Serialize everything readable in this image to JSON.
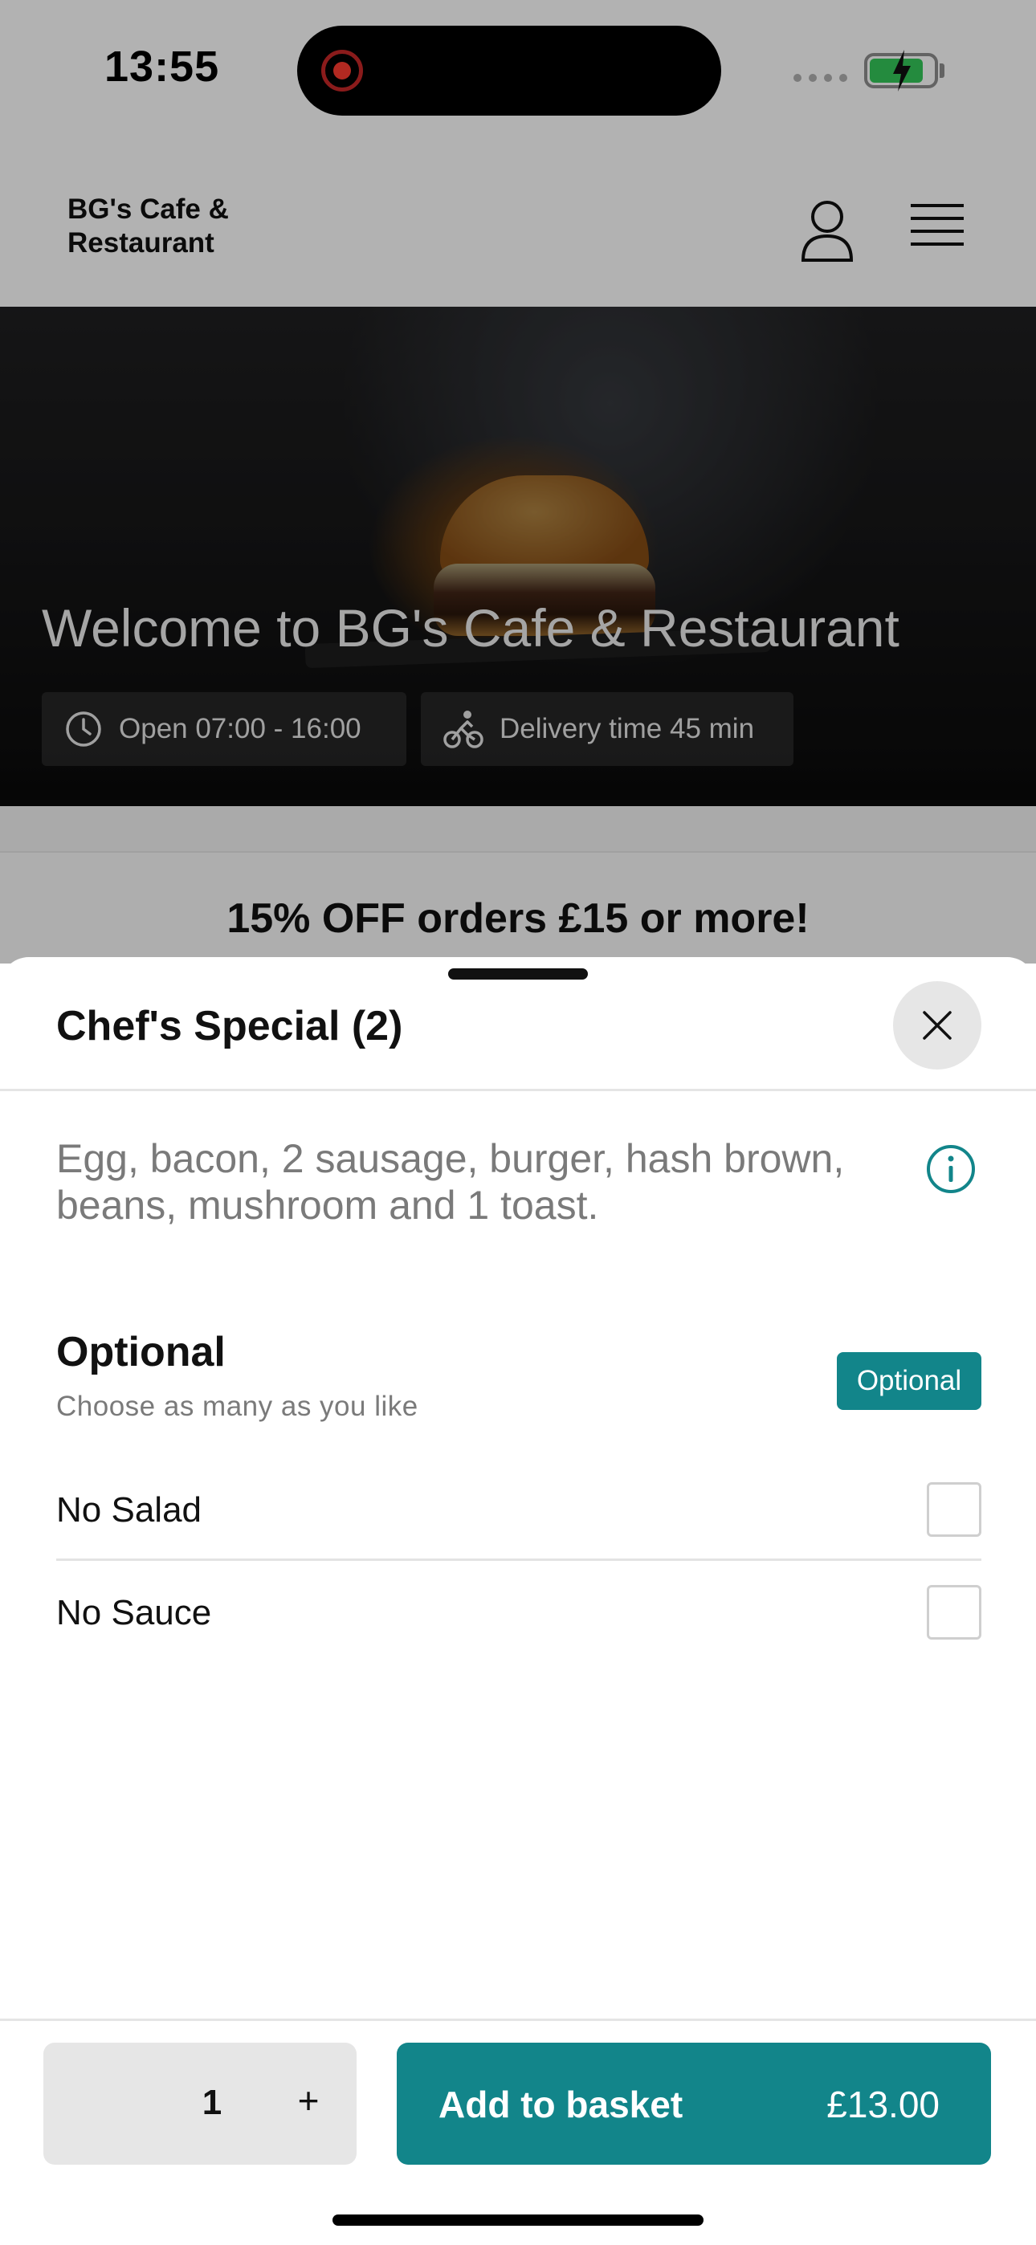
{
  "status_bar": {
    "time": "13:55",
    "battery_level": 0.85
  },
  "header": {
    "brand": "BG's Cafe & Restaurant",
    "account_icon": "person-icon",
    "menu_icon": "hamburger-menu-icon"
  },
  "hero": {
    "title": "Welcome to BG's Cafe & Restaurant",
    "open_hours": "Open 07:00 - 16:00",
    "delivery_time": "Delivery time 45 min"
  },
  "promo": {
    "text": "15% OFF orders £15 or more!"
  },
  "sheet": {
    "title": "Chef's Special (2)",
    "description": "Egg, bacon, 2 sausage, burger, hash brown, beans, mushroom and 1 toast.",
    "group": {
      "title": "Optional",
      "subtitle": "Choose as many as you like",
      "badge": "Optional",
      "options": [
        {
          "label": "No Salad",
          "checked": false
        },
        {
          "label": "No Sauce",
          "checked": false
        }
      ]
    },
    "footer": {
      "quantity": "1",
      "plus": "+",
      "add_label": "Add to basket",
      "price": "£13.00"
    }
  },
  "colors": {
    "accent": "#12858a",
    "scrim": "rgba(0,0,0,0.3)",
    "badge_text": "#ffffff"
  }
}
